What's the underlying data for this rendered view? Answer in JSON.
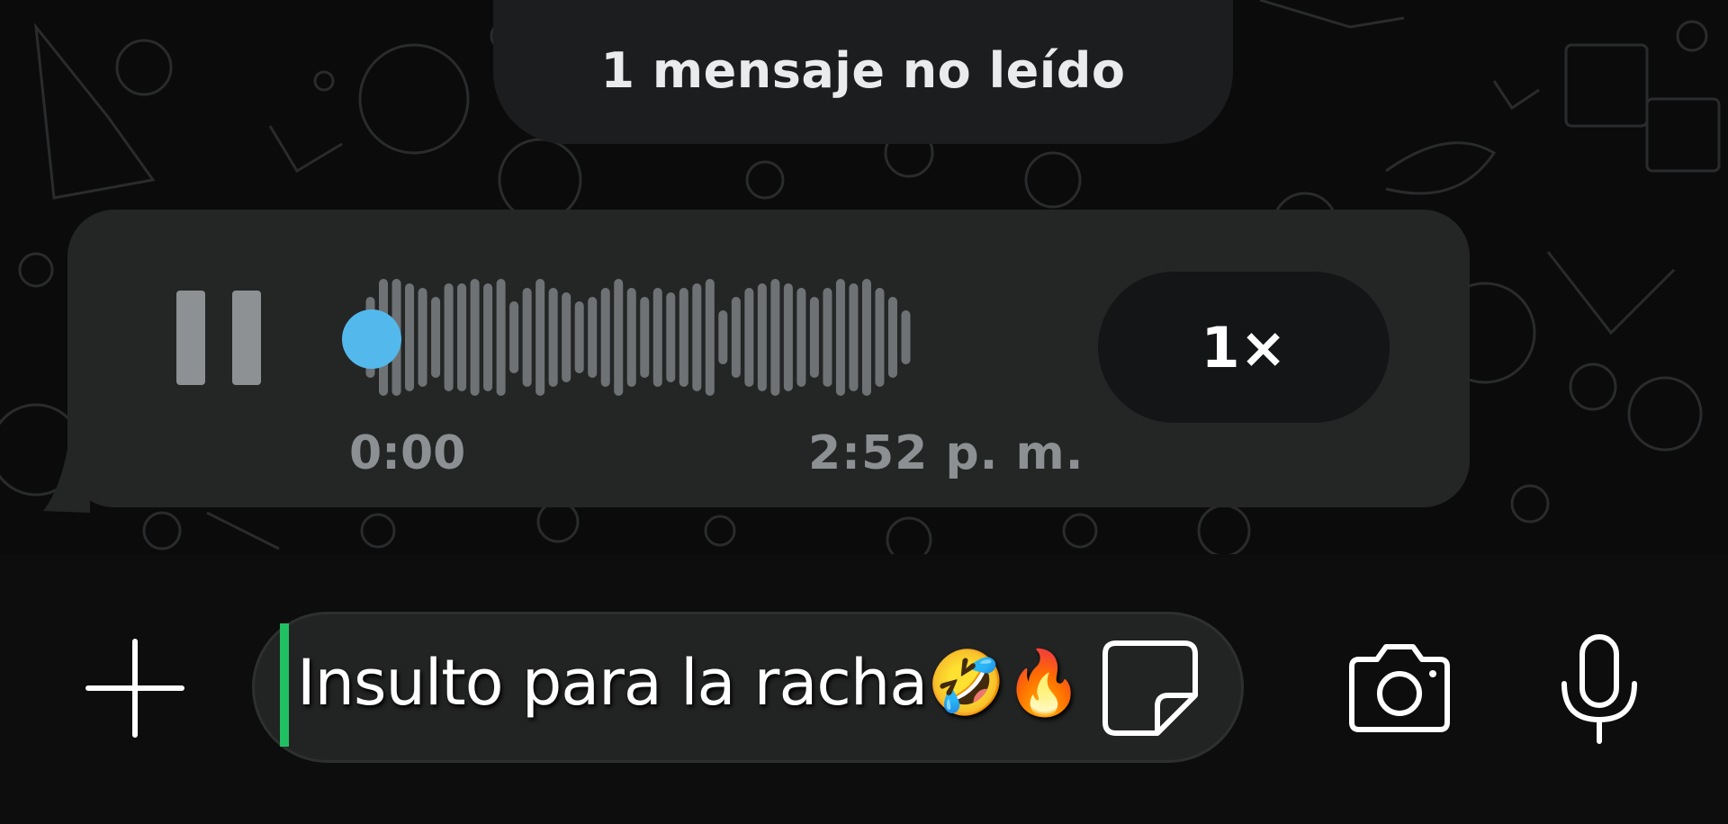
{
  "unread_banner": {
    "text": "1 mensaje no leído"
  },
  "voice_message": {
    "elapsed": "0:00",
    "timestamp": "2:52 p. m.",
    "speed": "1×",
    "progress": 0,
    "colors": {
      "bubble": "#242626",
      "progress_dot": "#53b9ec",
      "waveform": "#6f7274"
    }
  },
  "composer": {
    "text": "Insulto para la racha🤣🔥",
    "caret_color": "#21c063",
    "icons": {
      "add": "plus-icon",
      "sticker": "sticker-icon",
      "camera": "camera-icon",
      "mic": "microphone-icon"
    }
  }
}
